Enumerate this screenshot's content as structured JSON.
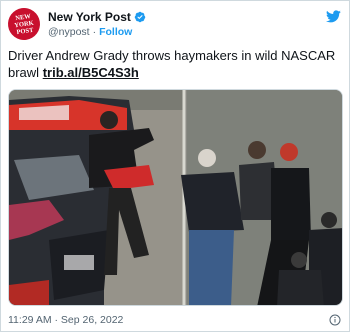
{
  "account": {
    "display_name": "New York Post",
    "handle": "@nypost",
    "separator": "·",
    "follow_label": "Follow",
    "avatar_logo_line1": "NEW",
    "avatar_logo_line2": "YORK",
    "avatar_logo_line3": "POST"
  },
  "tweet": {
    "text": "Driver Andrew Grady throws haymakers in wild NASCAR brawl",
    "link_text": "trib.al/B5C4S3h"
  },
  "media": {
    "alt": "Video still of a fight between race drivers in a pit area next to a race car"
  },
  "footer": {
    "timestamp": "11:29 AM · Sep 26, 2022"
  },
  "colors": {
    "brand_red": "#c8102e",
    "twitter_blue": "#1d9bf0",
    "text": "#0f1419",
    "muted": "#536471"
  },
  "icons": {
    "verified": "verified-badge-icon",
    "twitter": "twitter-bird-icon",
    "info": "info-icon"
  }
}
